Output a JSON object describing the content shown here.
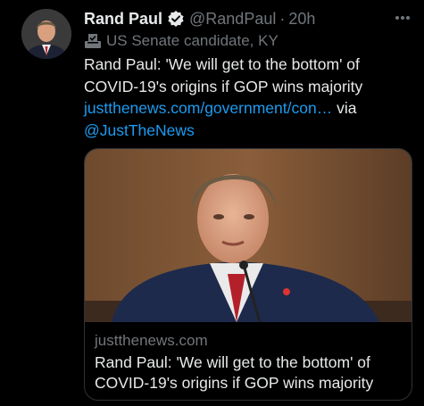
{
  "tweet": {
    "display_name": "Rand Paul",
    "handle": "@RandPaul",
    "separator": "·",
    "time": "20h",
    "label": "US Senate candidate, KY",
    "text_prefix": "Rand Paul: 'We will get to the bottom' of COVID-19's origins if GOP wins majority ",
    "link_text": "justthenews.com/government/con…",
    "text_middle": " via ",
    "mention": "@JustTheNews"
  },
  "card": {
    "domain": "justthenews.com",
    "title": "Rand Paul: 'We will get to the bottom' of COVID-19's origins if GOP wins majority"
  },
  "icons": {
    "verified": "verified-badge-icon",
    "label": "ballot-box-icon",
    "more": "more-options-icon"
  },
  "colors": {
    "background": "#000000",
    "primary_text": "#e7e9ea",
    "secondary_text": "#71767b",
    "link": "#1d9bf0",
    "border": "#2f3336"
  }
}
